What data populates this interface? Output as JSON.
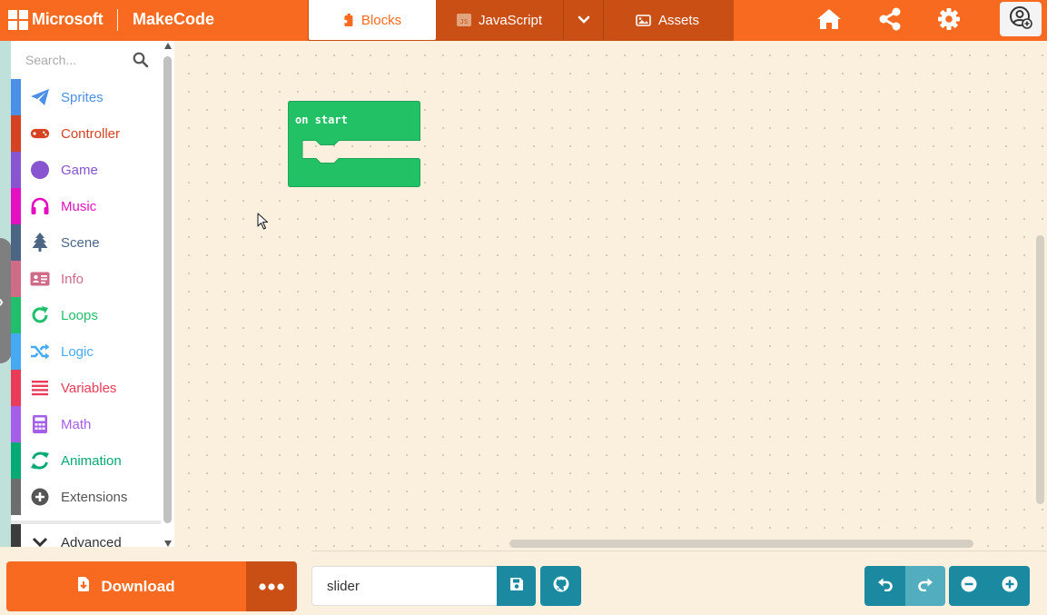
{
  "brand": {
    "company": "Microsoft",
    "app": "MakeCode"
  },
  "tabs": [
    {
      "label": "Blocks",
      "icon": "puzzle-icon",
      "active": true
    },
    {
      "label": "JavaScript",
      "icon": "js-file-icon",
      "active": false
    },
    {
      "label": "",
      "icon": "chevron-down-icon",
      "active": false
    },
    {
      "label": "Assets",
      "icon": "image-icon",
      "active": false
    }
  ],
  "header_icons": [
    "home-icon",
    "share-icon",
    "gear-icon",
    "user-icon"
  ],
  "toolbox": {
    "search_placeholder": "Search...",
    "categories": [
      {
        "label": "Sprites",
        "color": "#4b8fe8",
        "icon": "paper-plane-icon"
      },
      {
        "label": "Controller",
        "color": "#d54322",
        "icon": "gamepad-icon"
      },
      {
        "label": "Game",
        "color": "#8854d0",
        "icon": "circle-icon"
      },
      {
        "label": "Music",
        "color": "#e30fc0",
        "icon": "headphones-icon"
      },
      {
        "label": "Scene",
        "color": "#4b6584",
        "icon": "tree-icon"
      },
      {
        "label": "Info",
        "color": "#cf6a87",
        "icon": "id-card-icon"
      },
      {
        "label": "Loops",
        "color": "#20bf6b",
        "icon": "refresh-icon"
      },
      {
        "label": "Logic",
        "color": "#45aaf2",
        "icon": "shuffle-icon"
      },
      {
        "label": "Variables",
        "color": "#eb3b5a",
        "icon": "list-icon"
      },
      {
        "label": "Math",
        "color": "#a55eea",
        "icon": "calculator-icon"
      },
      {
        "label": "Animation",
        "color": "#03aa74",
        "icon": "sync-icon"
      },
      {
        "label": "Extensions",
        "color": "#6d6d6d",
        "icon": "plus-circle-icon"
      },
      {
        "label": "Advanced",
        "color": "#3c3c3c",
        "icon": "chevron-down-icon"
      }
    ]
  },
  "workspace": {
    "block": {
      "label": "on start",
      "color": "#23c165",
      "stroke": "#1fa55a"
    }
  },
  "bottom": {
    "download_label": "Download",
    "project_name": "slider"
  },
  "colors": {
    "accent": "#f86a1f",
    "accent_dark": "#c94f15",
    "teal": "#1b8aa1",
    "workspace_bg": "#fbf0de"
  }
}
